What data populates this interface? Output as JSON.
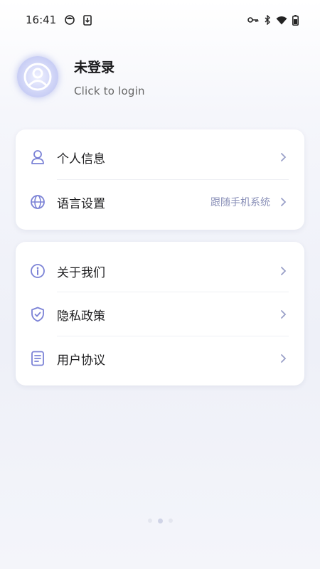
{
  "status_bar": {
    "time": "16:41"
  },
  "profile": {
    "name": "未登录",
    "subtitle": "Click to login"
  },
  "card1": {
    "items": [
      {
        "label": "个人信息",
        "value": "",
        "icon": "person-icon"
      },
      {
        "label": "语言设置",
        "value": "跟随手机系统",
        "icon": "globe-icon"
      }
    ]
  },
  "card2": {
    "items": [
      {
        "label": "关于我们",
        "icon": "info-icon"
      },
      {
        "label": "隐私政策",
        "icon": "shield-check-icon"
      },
      {
        "label": "用户协议",
        "icon": "document-icon"
      }
    ]
  },
  "colors": {
    "accent": "#7b82d6",
    "chevron": "#9aa0c8",
    "value_text": "#8a90b8"
  }
}
